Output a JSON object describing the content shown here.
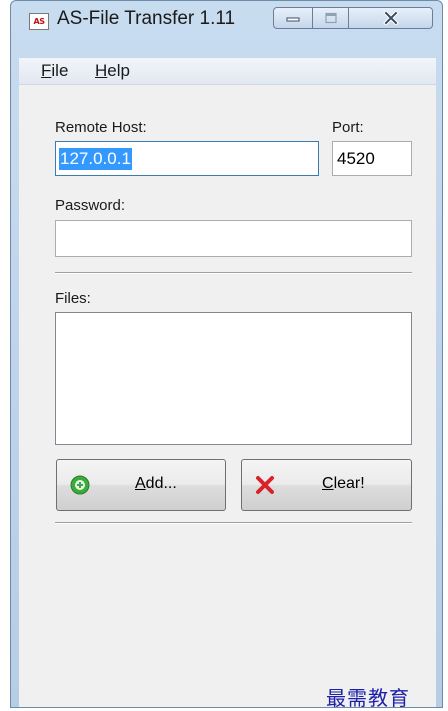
{
  "window": {
    "title": "AS-File Transfer 1.11",
    "icon_text": "AS",
    "icon": "app-icon",
    "controls": [
      "minimize-icon",
      "maximize-icon",
      "close-icon"
    ]
  },
  "menu": {
    "file_accel": "F",
    "file_rest": "ile",
    "help_accel": "H",
    "help_rest": "elp"
  },
  "form": {
    "remote_host_label": "Remote Host:",
    "remote_host_value": "127.0.0.1",
    "port_label": "Port:",
    "port_value": "4520",
    "password_label": "Password:",
    "password_value": "",
    "files_label": "Files:",
    "files": []
  },
  "buttons": {
    "add_accel": "A",
    "add_rest": "dd...",
    "add_icon": "plus-circle-icon",
    "clear_accel": "C",
    "clear_rest": "lear!",
    "clear_icon": "red-x-icon"
  },
  "watermark": "最需教育",
  "colors": {
    "selection": "#3399ff",
    "add_icon": "#3cab3c",
    "clear_icon": "#d9232b",
    "watermark": "#1d1fa8"
  }
}
